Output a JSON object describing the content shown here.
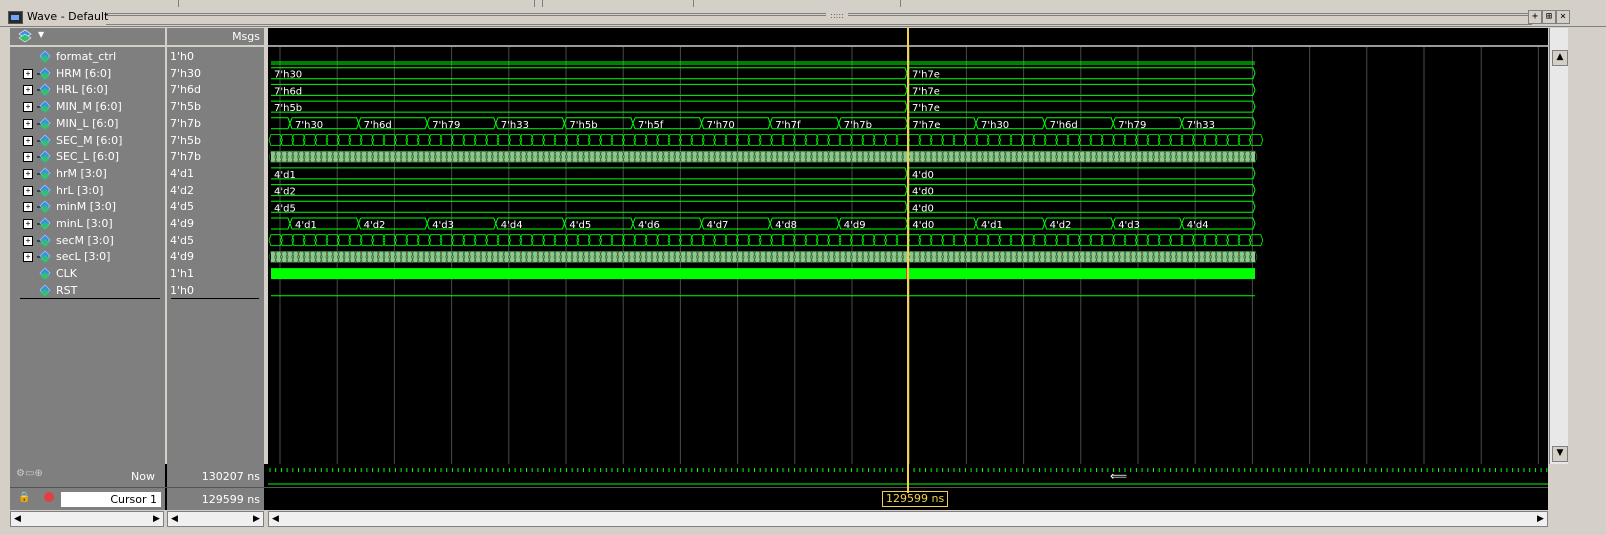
{
  "window": {
    "title": "Wave - Default",
    "buttons": [
      "+",
      "⊞",
      "×"
    ]
  },
  "names_header": {
    "icon": "wave-toolbar-icon"
  },
  "values_header": {
    "label": "Msgs"
  },
  "signals": [
    {
      "name": "format_ctrl",
      "value": "1'h0",
      "expandable": false,
      "kind": "bit"
    },
    {
      "name": "HRM [6:0]",
      "value": "7'h30",
      "expandable": true,
      "kind": "bus"
    },
    {
      "name": "HRL [6:0]",
      "value": "7'h6d",
      "expandable": true,
      "kind": "bus"
    },
    {
      "name": "MIN_M [6:0]",
      "value": "7'h5b",
      "expandable": true,
      "kind": "bus"
    },
    {
      "name": "MIN_L [6:0]",
      "value": "7'h7b",
      "expandable": true,
      "kind": "bus"
    },
    {
      "name": "SEC_M [6:0]",
      "value": "7'h5b",
      "expandable": true,
      "kind": "bus"
    },
    {
      "name": "SEC_L [6:0]",
      "value": "7'h7b",
      "expandable": true,
      "kind": "bus"
    },
    {
      "name": "hrM [3:0]",
      "value": "4'd1",
      "expandable": true,
      "kind": "bus"
    },
    {
      "name": "hrL [3:0]",
      "value": "4'd2",
      "expandable": true,
      "kind": "bus"
    },
    {
      "name": "minM [3:0]",
      "value": "4'd5",
      "expandable": true,
      "kind": "bus"
    },
    {
      "name": "minL [3:0]",
      "value": "4'd9",
      "expandable": true,
      "kind": "bus"
    },
    {
      "name": "secM [3:0]",
      "value": "4'd5",
      "expandable": true,
      "kind": "bus"
    },
    {
      "name": "secL [3:0]",
      "value": "4'd9",
      "expandable": true,
      "kind": "bus"
    },
    {
      "name": "CLK",
      "value": "1'h1",
      "expandable": false,
      "kind": "bit"
    },
    {
      "name": "RST",
      "value": "1'h0",
      "expandable": false,
      "kind": "bit"
    }
  ],
  "wave_labels": {
    "hrm_before": "7'h30",
    "hrm_after": "7'h7e",
    "hrl_before": "7'h6d",
    "hrl_after": "7'h7e",
    "minm_before": "7'h5b",
    "minm_after": "7'h7e",
    "minl_segments": [
      "7'h30",
      "7'h6d",
      "7'h79",
      "7'h33",
      "7'h5b",
      "7'h5f",
      "7'h70",
      "7'h7f",
      "7'h7b",
      "7'h7e",
      "7'h30",
      "7'h6d",
      "7'h79",
      "7'h33"
    ],
    "hrm4_before": "4'd1",
    "hrm4_after": "4'd0",
    "hrl4_before": "4'd2",
    "hrl4_after": "4'd0",
    "minm4_before": "4'd5",
    "minm4_after": "4'd0",
    "minl4_segments": [
      "4'd1",
      "4'd2",
      "4'd3",
      "4'd4",
      "4'd5",
      "4'd6",
      "4'd7",
      "4'd8",
      "4'd9",
      "4'd0",
      "4'd1",
      "4'd2",
      "4'd3",
      "4'd4"
    ]
  },
  "now": {
    "label": "Now",
    "value": "130207 ns"
  },
  "cursor": {
    "label": "Cursor 1",
    "value": "129599 ns",
    "marker": "129599 ns"
  },
  "colors": {
    "wave_green": "#00ff00",
    "bus_fill": "#a8e6a8",
    "cursor": "#f2d24b",
    "grid": "#4a4a4a",
    "rst_red": "#ff2a2a"
  }
}
